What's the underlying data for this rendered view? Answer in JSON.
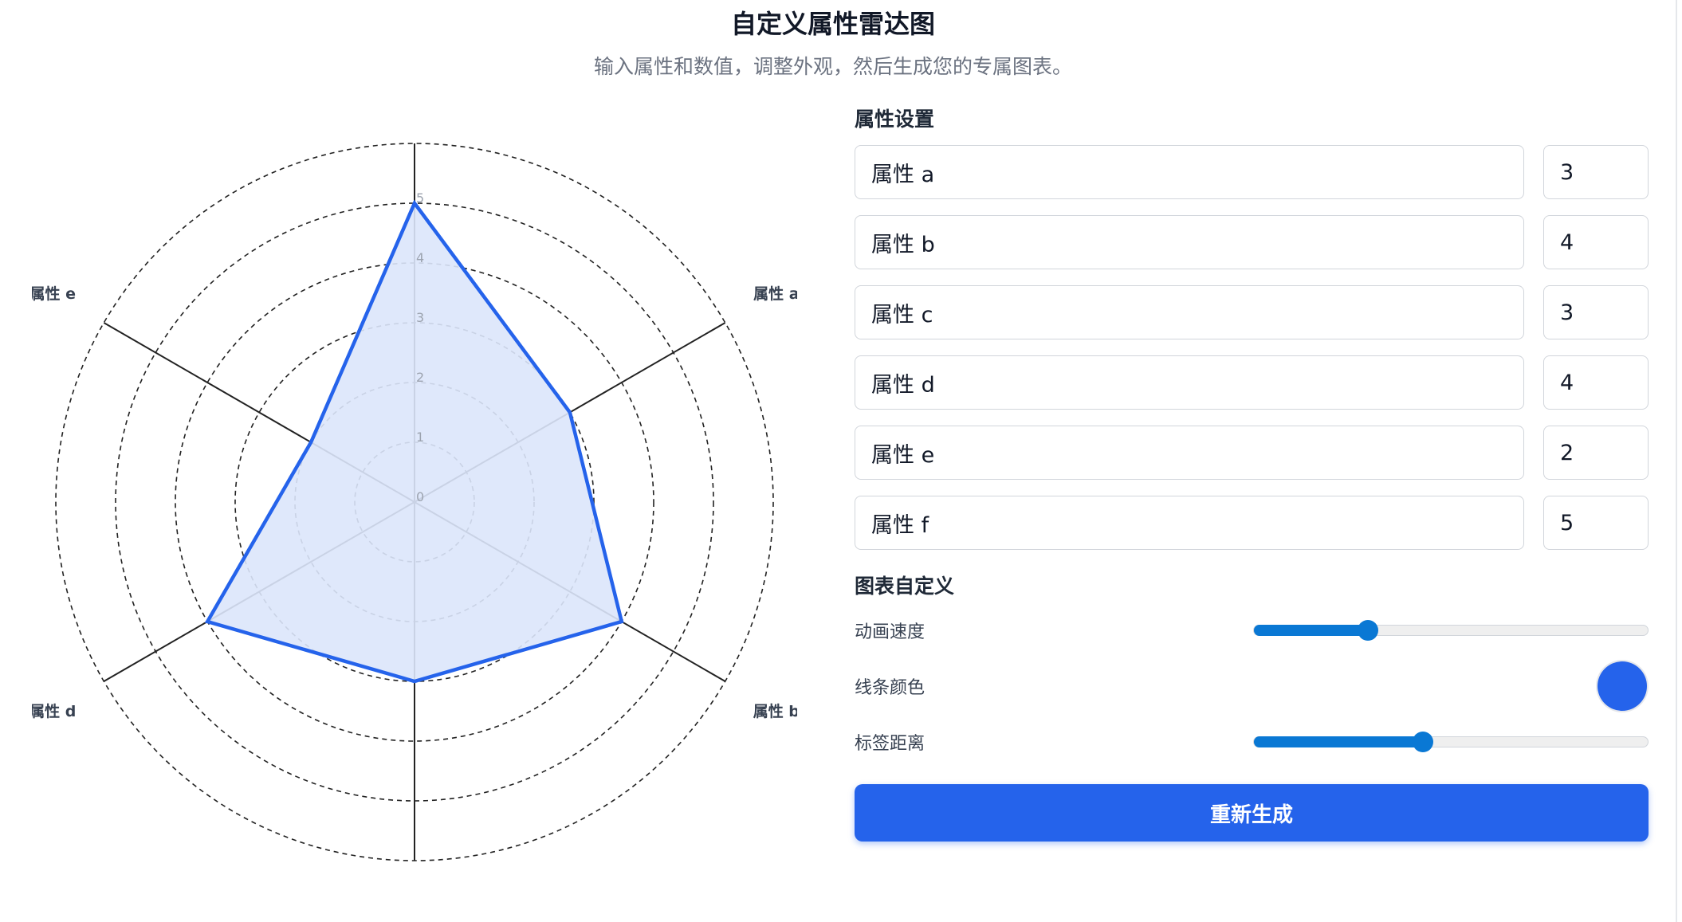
{
  "header": {
    "title": "自定义属性雷达图",
    "subtitle": "输入属性和数值，调整外观，然后生成您的专属图表。"
  },
  "settings": {
    "title": "属性设置",
    "attributes": [
      {
        "name": "属性 a",
        "value": "3"
      },
      {
        "name": "属性 b",
        "value": "4"
      },
      {
        "name": "属性 c",
        "value": "3"
      },
      {
        "name": "属性 d",
        "value": "4"
      },
      {
        "name": "属性 e",
        "value": "2"
      },
      {
        "name": "属性 f",
        "value": "5"
      }
    ]
  },
  "customize": {
    "title": "图表自定义",
    "animation_speed_label": "动画速度",
    "animation_speed_level": 0.29,
    "line_color_label": "线条颜色",
    "line_color": "#2563eb",
    "label_distance_label": "标签距离",
    "label_distance_level": 0.43
  },
  "regenerate_label": "重新生成",
  "chart_data": {
    "type": "radar",
    "categories": [
      "属性 a",
      "属性 b",
      "属性 c",
      "属性 d",
      "属性 e",
      "属性 f"
    ],
    "values": [
      3,
      4,
      3,
      4,
      2,
      5
    ],
    "range": [
      0,
      5
    ],
    "tick_labels": [
      "0",
      "1",
      "2",
      "3",
      "4",
      "5"
    ],
    "line_color": "#2563eb",
    "fill_color": "#dbe5fb",
    "grid": true
  }
}
